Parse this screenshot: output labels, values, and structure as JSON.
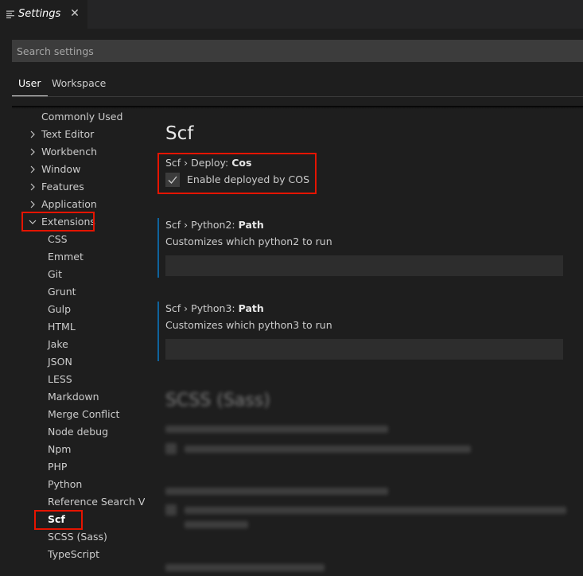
{
  "tab": {
    "title": "Settings",
    "icon": "settings-icon",
    "close_icon": "close-icon"
  },
  "search": {
    "placeholder": "Search settings",
    "value": ""
  },
  "scope_tabs": [
    {
      "label": "User",
      "active": true
    },
    {
      "label": "Workspace",
      "active": false
    }
  ],
  "toc": {
    "items": [
      {
        "label": "Commonly Used",
        "expandable": false
      },
      {
        "label": "Text Editor",
        "expandable": true,
        "expanded": false
      },
      {
        "label": "Workbench",
        "expandable": true,
        "expanded": false
      },
      {
        "label": "Window",
        "expandable": true,
        "expanded": false
      },
      {
        "label": "Features",
        "expandable": true,
        "expanded": false
      },
      {
        "label": "Application",
        "expandable": true,
        "expanded": false
      },
      {
        "label": "Extensions",
        "expandable": true,
        "expanded": true
      }
    ],
    "extensions": [
      "CSS",
      "Emmet",
      "Git",
      "Grunt",
      "Gulp",
      "HTML",
      "Jake",
      "JSON",
      "LESS",
      "Markdown",
      "Merge Conflict",
      "Node debug",
      "Npm",
      "PHP",
      "Python",
      "Reference Search V...",
      "Scf",
      "SCSS (Sass)",
      "TypeScript"
    ],
    "selected": "Scf"
  },
  "main": {
    "section_title": "Scf",
    "settings": [
      {
        "prefix": "Scf › Deploy: ",
        "name": "Cos",
        "type": "checkbox",
        "checked": true,
        "label": "Enable deployed by COS"
      },
      {
        "prefix": "Scf › Python2: ",
        "name": "Path",
        "type": "text",
        "description": "Customizes which python2 to run",
        "value": ""
      },
      {
        "prefix": "Scf › Python3: ",
        "name": "Path",
        "type": "text",
        "description": "Customizes which python3 to run",
        "value": ""
      }
    ],
    "faded_section_title": "SCSS (Sass)"
  },
  "colors": {
    "highlight": "#e51400",
    "modified_bar": "#0e639c",
    "background": "#1e1e1e"
  }
}
